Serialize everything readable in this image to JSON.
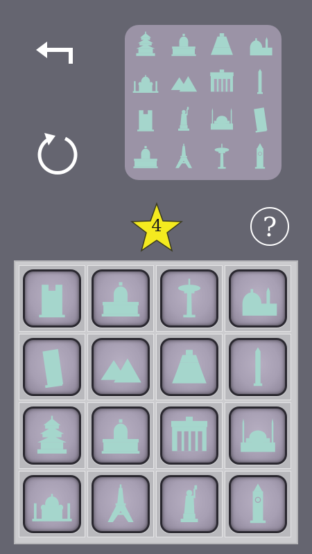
{
  "header": {
    "back_icon": "back-arrow-icon",
    "reset_icon": "reset-circular-arrow-icon",
    "help_icon": "question-mark-icon",
    "help_label": "?"
  },
  "score": {
    "stars": "4",
    "star_icon": "star-icon",
    "star_color": "#f4ea1f"
  },
  "colors": {
    "background": "#656570",
    "landmark": "#a5d6cc",
    "tile_face": "#a79fb3",
    "board": "#cccccf"
  },
  "preview": {
    "cells": [
      "temple-of-heaven",
      "us-capitol",
      "chichen-itza-pyramid",
      "florence-cathedral",
      "taj-mahal",
      "pyramids-of-giza",
      "brandenburg-gate",
      "washington-monument",
      "notre-dame",
      "statue-of-liberty",
      "hagia-sophia",
      "leaning-tower-of-pisa",
      "us-capitol",
      "eiffel-tower",
      "space-needle",
      "big-ben"
    ]
  },
  "board": {
    "tiles": [
      "notre-dame",
      "us-capitol",
      "space-needle",
      "florence-cathedral",
      "leaning-tower-of-pisa",
      "pyramids-of-giza",
      "chichen-itza-pyramid",
      "washington-monument",
      "temple-of-heaven",
      "us-capitol",
      "brandenburg-gate",
      "hagia-sophia",
      "taj-mahal",
      "eiffel-tower",
      "statue-of-liberty",
      "big-ben"
    ]
  }
}
